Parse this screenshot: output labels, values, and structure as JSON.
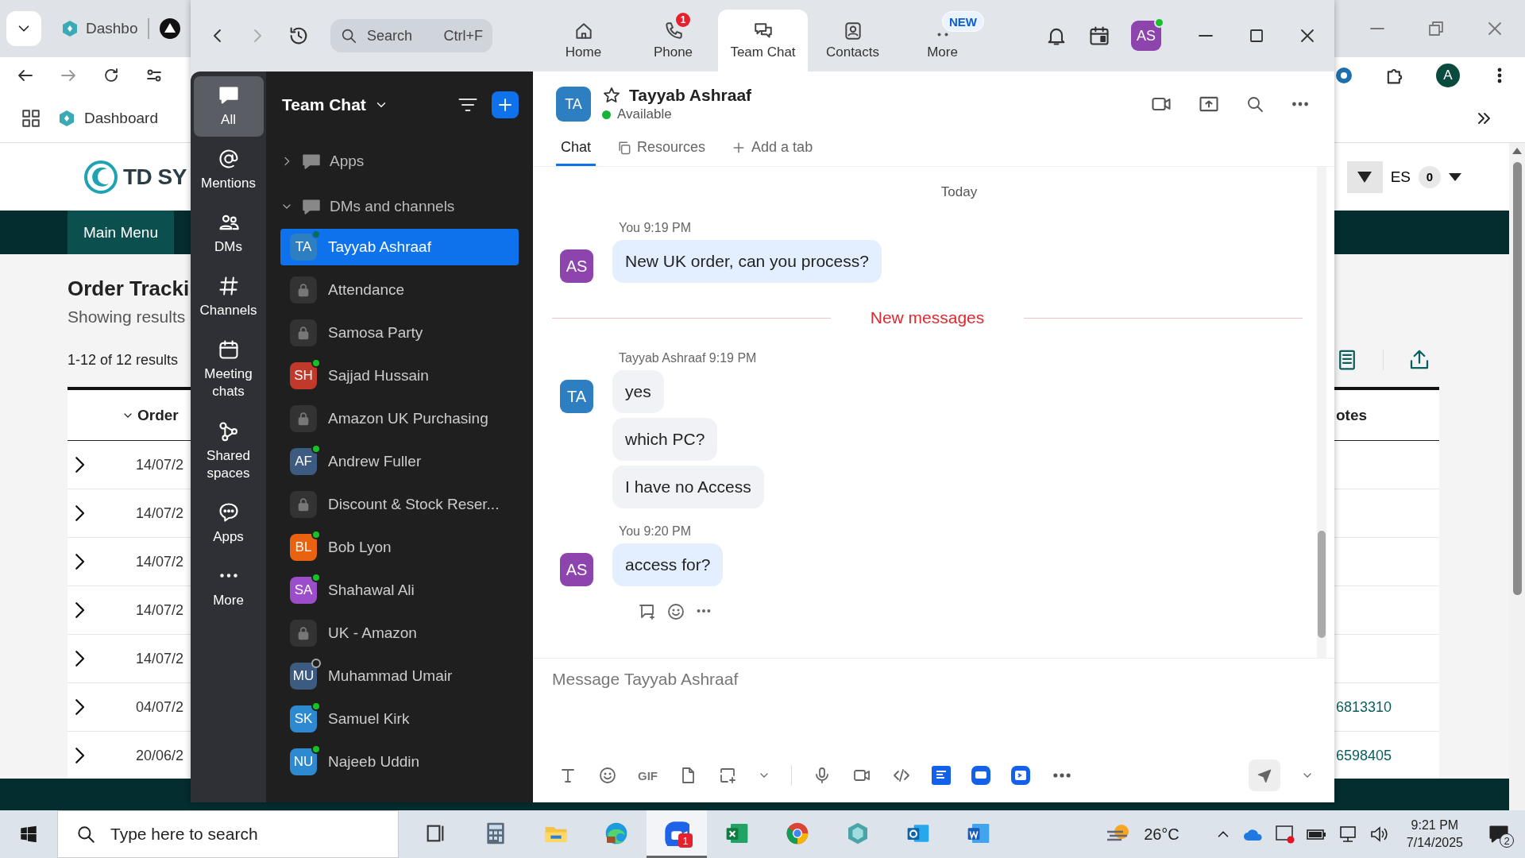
{
  "browser": {
    "tab_label": "Dashbo",
    "bookmark": "Dashboard",
    "profile_initial": "A",
    "page": {
      "logo_text": "TD SY",
      "nav": [
        {
          "label": "Main Menu",
          "selected": true
        }
      ],
      "language": "ES",
      "language_badge": "0",
      "title": "Order Tracki",
      "subtitle": "Showing results",
      "results_count": "1-12 of 12 results",
      "columns": [
        "Order",
        "otes"
      ],
      "rows": [
        {
          "date": "14/07/2"
        },
        {
          "date": "14/07/2"
        },
        {
          "date": "14/07/2"
        },
        {
          "date": "14/07/2"
        },
        {
          "date": "14/07/2"
        },
        {
          "date": "04/07/2",
          "notes": "6813310"
        },
        {
          "date": "20/06/2",
          "notes": "6598405"
        }
      ]
    }
  },
  "zoom": {
    "search": {
      "placeholder": "Search",
      "shortcut": "Ctrl+F"
    },
    "tabs": [
      {
        "label": "Home",
        "selected": false
      },
      {
        "label": "Phone",
        "selected": false,
        "badge": "1"
      },
      {
        "label": "Team Chat",
        "selected": true
      },
      {
        "label": "Contacts",
        "selected": false
      },
      {
        "label": "More",
        "selected": false,
        "badge": "NEW"
      }
    ],
    "user_initials": "AS",
    "rail": [
      {
        "label": "All",
        "selected": true
      },
      {
        "label": "Mentions",
        "selected": false
      },
      {
        "label": "DMs",
        "selected": false
      },
      {
        "label": "Channels",
        "selected": false
      },
      {
        "label": "Meeting chats",
        "selected": false
      },
      {
        "label": "Shared spaces",
        "selected": false
      },
      {
        "label": "Apps",
        "selected": false
      },
      {
        "label": "More",
        "selected": false
      }
    ],
    "list_title": "Team Chat",
    "sections": [
      {
        "label": "Apps",
        "expanded": false
      },
      {
        "label": "DMs and channels",
        "expanded": true
      }
    ],
    "items": [
      {
        "kind": "dm",
        "initials": "TA",
        "color": "#2d7fc1",
        "name": "Tayyab Ashraaf",
        "online": true,
        "selected": true
      },
      {
        "kind": "channel",
        "name": "Attendance",
        "selected": false
      },
      {
        "kind": "channel",
        "name": "Samosa Party",
        "selected": false
      },
      {
        "kind": "dm",
        "initials": "SH",
        "color": "#c0392b",
        "name": "Sajjad Hussain",
        "online": true,
        "selected": false
      },
      {
        "kind": "channel",
        "name": "Amazon UK Purchasing",
        "selected": false
      },
      {
        "kind": "dm",
        "initials": "AF",
        "color": "#3d5a80",
        "name": "Andrew Fuller",
        "online": true,
        "selected": false
      },
      {
        "kind": "channel",
        "name": "Discount & Stock Reser...",
        "selected": false
      },
      {
        "kind": "dm",
        "initials": "BL",
        "color": "#e8620f",
        "name": "Bob Lyon",
        "online": true,
        "selected": false
      },
      {
        "kind": "dm",
        "initials": "SA",
        "color": "#9b4dca",
        "name": "Shahawal Ali",
        "online": true,
        "selected": false
      },
      {
        "kind": "channel",
        "name": "UK - Amazon",
        "selected": false
      },
      {
        "kind": "dm",
        "initials": "MU",
        "color": "#3d5a80",
        "name": "Muhammad Umair",
        "online": false,
        "selected": false
      },
      {
        "kind": "dm",
        "initials": "SK",
        "color": "#2d8ad0",
        "name": "Samuel Kirk",
        "online": true,
        "selected": false
      },
      {
        "kind": "dm",
        "initials": "NU",
        "color": "#2d8ad0",
        "name": "Najeeb Uddin",
        "online": true,
        "selected": false
      }
    ],
    "chat": {
      "initials": "TA",
      "name": "Tayyab Ashraaf",
      "status": "Available",
      "starred": false,
      "tabs": [
        {
          "label": "Chat",
          "selected": true
        },
        {
          "label": "Resources",
          "selected": false
        },
        {
          "label": "Add a tab",
          "selected": false
        }
      ],
      "messages": [
        {
          "kind": "divider",
          "text": "Today"
        },
        {
          "kind": "group",
          "initials": "AS",
          "color": "#8e44ad",
          "sender": "You",
          "time": "9:19 PM",
          "mine": true,
          "bubbles": [
            "New UK order, can you process?"
          ]
        },
        {
          "kind": "new",
          "text": "New messages"
        },
        {
          "kind": "group",
          "initials": "TA",
          "color": "#2d7fc1",
          "sender": "Tayyab Ashraaf",
          "time": "9:19 PM",
          "mine": false,
          "bubbles": [
            "yes",
            "which PC?",
            "I have no Access"
          ]
        },
        {
          "kind": "group",
          "initials": "AS",
          "color": "#8e44ad",
          "sender": "You",
          "time": "9:20 PM",
          "mine": true,
          "bubbles": [
            "access for?"
          ]
        }
      ],
      "composer": {
        "placeholder": "Message Tayyab Ashraaf",
        "gif": "GIF"
      }
    }
  },
  "taskbar": {
    "search_placeholder": "Type here to search",
    "apps": [
      {
        "kind": "taskview",
        "selected": false
      },
      {
        "kind": "calculator",
        "selected": false
      },
      {
        "kind": "explorer",
        "selected": false
      },
      {
        "kind": "edge",
        "selected": false
      },
      {
        "kind": "zoom",
        "selected": true,
        "badge": "1"
      },
      {
        "kind": "excel",
        "selected": false
      },
      {
        "kind": "chrome",
        "selected": false
      },
      {
        "kind": "gem",
        "selected": false
      },
      {
        "kind": "outlook",
        "selected": false
      },
      {
        "kind": "word",
        "selected": false
      }
    ],
    "temperature": "26°C",
    "time": "9:21 PM",
    "date": "7/14/2025",
    "notifications": "2"
  }
}
